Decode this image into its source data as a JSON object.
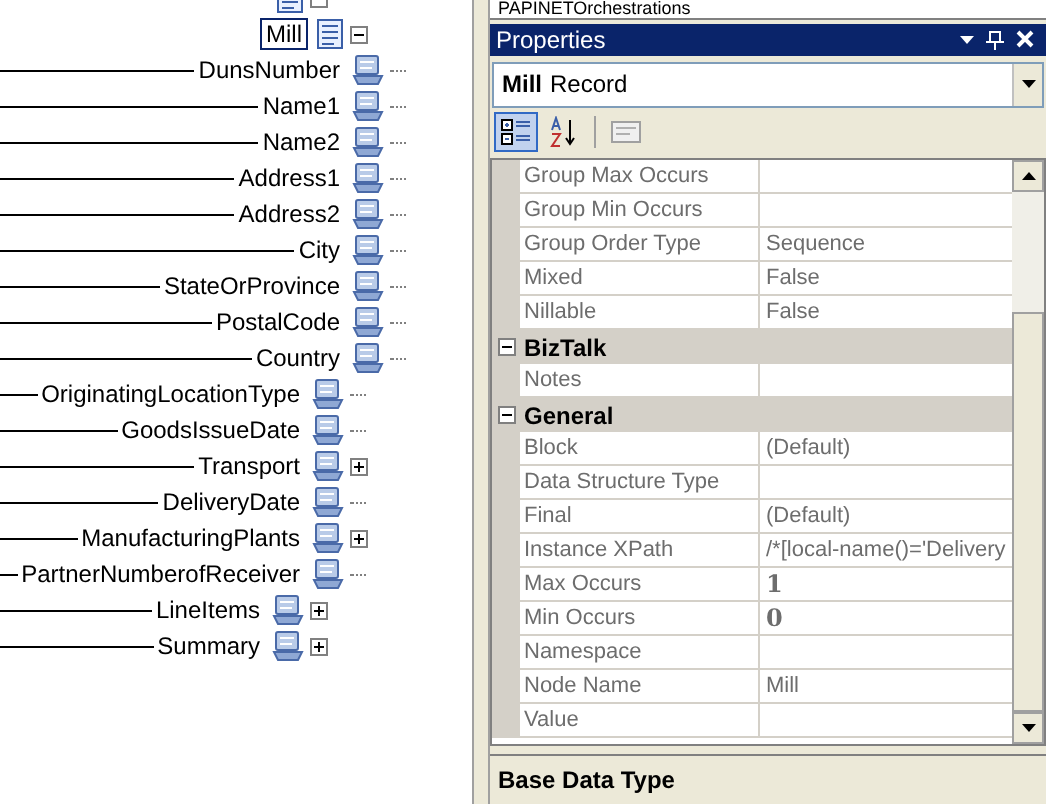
{
  "tree": [
    {
      "expanded": true,
      "kind": "record",
      "children": [
        {
          "label": "Mill",
          "kind": "record",
          "selected": true,
          "linked": false,
          "expanded": true,
          "children": [
            {
              "label": "DunsNumber",
              "kind": "field",
              "selected": false,
              "linked": true
            },
            {
              "label": "Name1",
              "kind": "field",
              "selected": false,
              "linked": true
            },
            {
              "label": "Name2",
              "kind": "field",
              "selected": false,
              "linked": true
            },
            {
              "label": "Address1",
              "kind": "field",
              "selected": false,
              "linked": true
            },
            {
              "label": "Address2",
              "kind": "field",
              "selected": false,
              "linked": true
            },
            {
              "label": "City",
              "kind": "field",
              "selected": false,
              "linked": true
            },
            {
              "label": "StateOrProvince",
              "kind": "field",
              "selected": false,
              "linked": true
            },
            {
              "label": "PostalCode",
              "kind": "field",
              "selected": false,
              "linked": true
            },
            {
              "label": "Country",
              "kind": "field",
              "selected": false,
              "linked": true
            }
          ]
        },
        {
          "label": "OriginatingLocationType",
          "kind": "field",
          "selected": false,
          "linked": true
        },
        {
          "label": "GoodsIssueDate",
          "kind": "field",
          "selected": false,
          "linked": true
        },
        {
          "label": "Transport",
          "kind": "field",
          "selected": false,
          "linked": true,
          "expanded": false
        },
        {
          "label": "DeliveryDate",
          "kind": "field",
          "selected": false,
          "linked": true
        },
        {
          "label": "ManufacturingPlants",
          "kind": "field",
          "selected": false,
          "linked": true,
          "expanded": false
        },
        {
          "label": "PartnerNumberofReceiver",
          "kind": "field",
          "selected": false,
          "linked": true
        }
      ]
    },
    {
      "label": "LineItems",
      "kind": "field",
      "selected": false,
      "linked": true,
      "expanded": false
    },
    {
      "label": "Summary",
      "kind": "field",
      "selected": false,
      "linked": true,
      "expanded": false
    }
  ],
  "solution_item": "PAPINETOrchestrations",
  "properties": {
    "title": "Properties",
    "object_name": "Mill",
    "object_type": "Record",
    "toolbar": [
      {
        "kind": "categorized",
        "selected": true
      },
      {
        "kind": "alphabetical",
        "selected": false
      },
      {
        "kind": "pages",
        "selected": false,
        "disabled": true
      }
    ],
    "rows": [
      {
        "kind": "property",
        "name": "Group Max Occurs"
      },
      {
        "kind": "property",
        "name": "Group Min Occurs"
      },
      {
        "kind": "property",
        "name": "Group Order Type",
        "value": "Sequence"
      },
      {
        "kind": "property",
        "name": "Mixed",
        "value": "False"
      },
      {
        "kind": "property",
        "name": "Nillable",
        "value": "False"
      },
      {
        "kind": "category",
        "name": "BizTalk",
        "expanded": true
      },
      {
        "kind": "property",
        "name": "Notes"
      },
      {
        "kind": "category",
        "name": "General",
        "expanded": true
      },
      {
        "kind": "property",
        "name": "Block",
        "value": "(Default)"
      },
      {
        "kind": "property",
        "name": "Data Structure Type"
      },
      {
        "kind": "property",
        "name": "Final",
        "value": "(Default)"
      },
      {
        "kind": "property",
        "name": "Instance XPath",
        "value": "/*[local-name()='Delivery"
      },
      {
        "kind": "property",
        "name": "Max Occurs",
        "value": "1",
        "bold_value": true
      },
      {
        "kind": "property",
        "name": "Min Occurs",
        "value": "0",
        "bold_value": true
      },
      {
        "kind": "property",
        "name": "Namespace"
      },
      {
        "kind": "property",
        "name": "Node Name",
        "value": "Mill"
      },
      {
        "kind": "property",
        "name": "Value"
      }
    ],
    "description_title": "Base Data Type"
  }
}
